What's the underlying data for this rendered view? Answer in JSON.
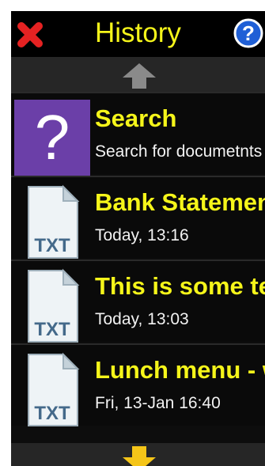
{
  "header": {
    "title": "History",
    "close_icon": "close-icon",
    "help_icon": "help-icon"
  },
  "colors": {
    "accent_yellow": "#f5f51a",
    "background": "#0d0d0d",
    "search_tile": "#6b3fa8",
    "close_red": "#e52222",
    "help_blue": "#1f5fd6"
  },
  "scroll": {
    "up_icon": "arrow-up-icon",
    "down_icon": "arrow-down-icon"
  },
  "items": [
    {
      "icon": "question-mark-icon",
      "glyph": "?",
      "title": "Search",
      "subtitle": "Search for documetnts"
    },
    {
      "icon": "txt-file-icon",
      "badge": "TXT",
      "title": "Bank Statement",
      "subtitle": "Today, 13:16"
    },
    {
      "icon": "txt-file-icon",
      "badge": "TXT",
      "title": "This is some text",
      "subtitle": "Today, 13:03"
    },
    {
      "icon": "txt-file-icon",
      "badge": "TXT",
      "title": "Lunch menu - week",
      "subtitle": "Fri, 13-Jan 16:40"
    }
  ]
}
